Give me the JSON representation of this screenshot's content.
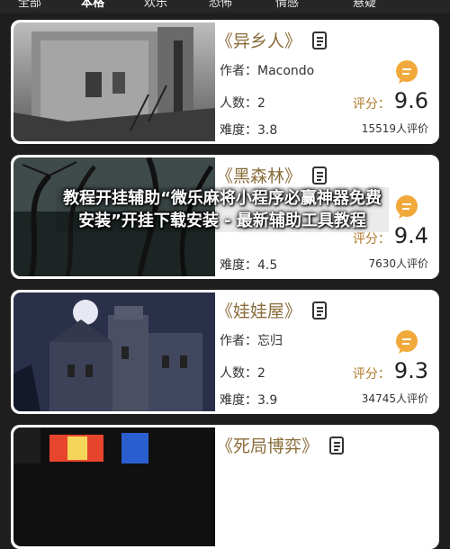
{
  "tabs": [
    "全部",
    "本格",
    "欢乐",
    "恐怖",
    "情感",
    "悬疑"
  ],
  "overlay_text": "教程开挂辅助“微乐麻将小程序必赢神器免费安装”开挂下载安装 - 最新辅助工具教程",
  "labels": {
    "author_prefix": "作者：",
    "players_prefix": "人数：",
    "difficulty_prefix": "难度：",
    "score_label": "评分：",
    "reviews_suffix": "人评价"
  },
  "cards": [
    {
      "title": "《异乡人》",
      "author": "Macondo",
      "players": "2",
      "difficulty": "3.8",
      "score": "9.6",
      "reviews": "15519"
    },
    {
      "title": "《黑森林》",
      "author": "",
      "players": "",
      "difficulty": "4.5",
      "score": "9.4",
      "reviews": "7630"
    },
    {
      "title": "《娃娃屋》",
      "author": "忘归",
      "players": "2",
      "difficulty": "3.9",
      "score": "9.3",
      "reviews": "34745"
    },
    {
      "title": "《死局博弈》",
      "author": "",
      "players": "",
      "difficulty": "",
      "score": "",
      "reviews": ""
    }
  ],
  "colors": {
    "title": "#8a6d3b",
    "chat_icon": "#f2a93b",
    "card_bg": "#ffffff",
    "page_bg": "#1e1e1e"
  }
}
